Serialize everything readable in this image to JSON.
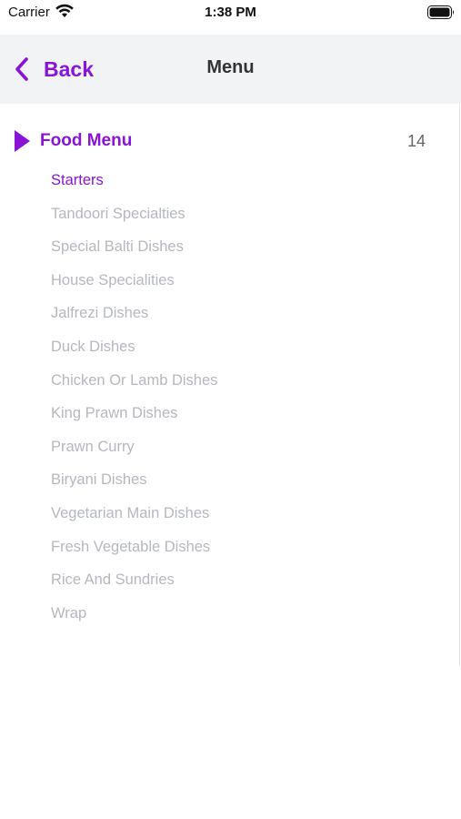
{
  "status_bar": {
    "carrier": "Carrier",
    "time": "1:38 PM",
    "icons": [
      "wifi-icon",
      "battery-icon"
    ]
  },
  "nav": {
    "back_label": "Back",
    "title": "Menu",
    "back_icon": "chevron-left-icon"
  },
  "menu": {
    "header_label": "Food Menu",
    "header_icon": "triangle-right-icon",
    "count": "14",
    "items": [
      {
        "label": "Starters",
        "active": true
      },
      {
        "label": "Tandoori Specialties",
        "active": false
      },
      {
        "label": "Special Balti Dishes",
        "active": false
      },
      {
        "label": "House Specialities",
        "active": false
      },
      {
        "label": "Jalfrezi Dishes",
        "active": false
      },
      {
        "label": "Duck Dishes",
        "active": false
      },
      {
        "label": "Chicken Or Lamb Dishes",
        "active": false
      },
      {
        "label": "King Prawn Dishes",
        "active": false
      },
      {
        "label": "Prawn Curry",
        "active": false
      },
      {
        "label": "Biryani Dishes",
        "active": false
      },
      {
        "label": "Vegetarian Main Dishes",
        "active": false
      },
      {
        "label": "Fresh Vegetable Dishes",
        "active": false
      },
      {
        "label": "Rice And Sundries",
        "active": false
      },
      {
        "label": "Wrap",
        "active": false
      }
    ]
  },
  "colors": {
    "accent": "#8a14d6",
    "inactive_text": "#b5b8be",
    "nav_background": "#f2f3f5",
    "count_text": "#666666"
  }
}
